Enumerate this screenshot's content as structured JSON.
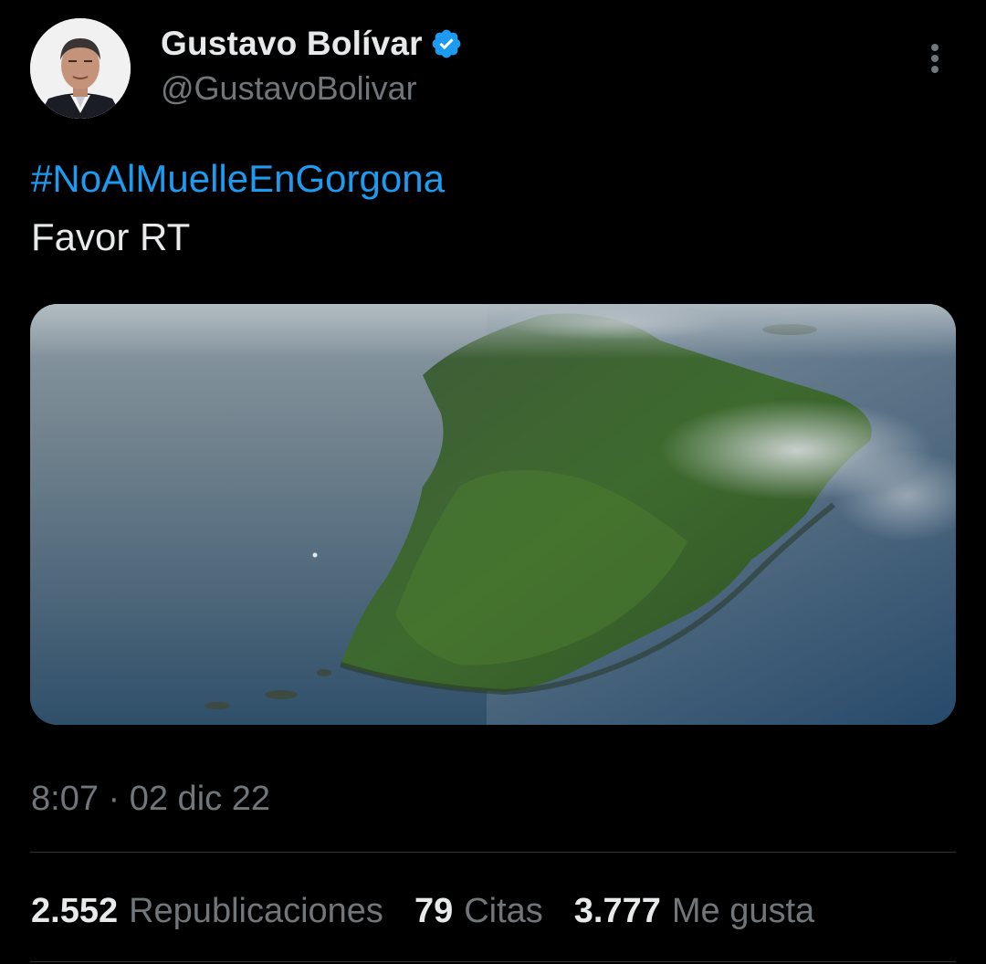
{
  "author": {
    "display_name": "Gustavo Bolívar",
    "handle": "@GustavoBolivar",
    "verified": true,
    "verified_color": "#1d9bf0"
  },
  "tweet": {
    "hashtag": "#NoAlMuelleEnGorgona",
    "text": "Favor RT",
    "timestamp": "8:07 · 02 dic 22"
  },
  "stats": {
    "reposts_count": "2.552",
    "reposts_label": "Republicaciones",
    "quotes_count": "79",
    "quotes_label": "Citas",
    "likes_count": "3.777",
    "likes_label": "Me gusta"
  },
  "colors": {
    "background": "#000000",
    "text_primary": "#e7e9ea",
    "text_secondary": "#71767b",
    "link": "#1d9bf0",
    "divider": "#2f3336"
  },
  "icons": {
    "verified": "verified-badge-icon",
    "more": "more-options-icon"
  }
}
